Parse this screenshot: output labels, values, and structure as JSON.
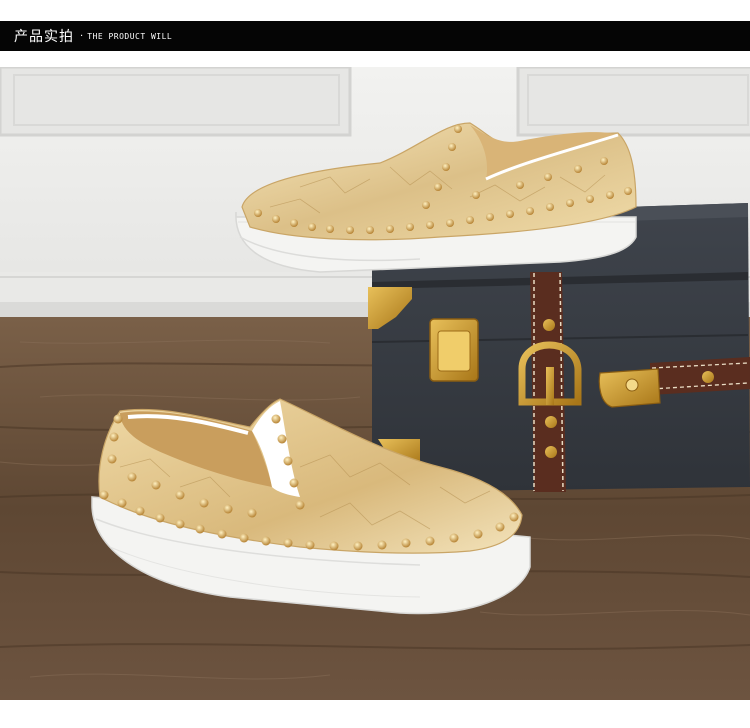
{
  "header": {
    "title_cn": "产品实拍",
    "separator": "·",
    "title_en": "THE PRODUCT WILL"
  },
  "photo": {
    "subject": "gold-studded-slip-on-shoes",
    "colors": {
      "wall": "#ededeb",
      "floor": "#6b5440",
      "suitcase": "#3b3f46",
      "leather": "#e9d29a",
      "sole": "#f4f4f2",
      "strap": "#5a2d1f",
      "hardware": "#c7942f"
    }
  }
}
